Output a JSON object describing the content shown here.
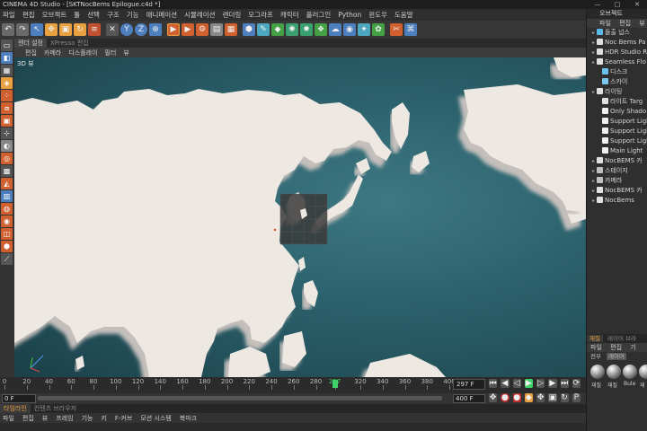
{
  "window": {
    "title": "CINEMA 4D Studio - [SKTNocBems Epilogue.c4d *]",
    "controls": [
      "—",
      "□",
      "✕"
    ]
  },
  "menubar": [
    "파일",
    "편집",
    "오브젝트",
    "툴",
    "선택",
    "구조",
    "기능",
    "애니메이션",
    "시뮬레이션",
    "렌더링",
    "모그라프",
    "캐릭터",
    "플러그인",
    "Python",
    "윈도우",
    "도움말"
  ],
  "viewport_tabs": [
    "렌더 설정",
    "XPresso 편집"
  ],
  "viewport_menu": [
    "편집",
    "카메라",
    "디스플레이",
    "필터",
    "뷰"
  ],
  "viewport_label": "3D 뷰",
  "timeline": {
    "ticks": [
      0,
      20,
      40,
      60,
      80,
      100,
      120,
      140,
      160,
      180,
      200,
      220,
      240,
      260,
      280,
      297,
      320,
      340,
      360,
      380,
      400
    ],
    "current_frame": "297 F",
    "start_field": "0 F",
    "end_field": "400 F"
  },
  "bottom_tabs": [
    "타임라인",
    "컨텐츠 브라우저"
  ],
  "bottom_menu": [
    "파일",
    "편집",
    "뷰",
    "프레임",
    "기능",
    "키",
    "F-커브",
    "모션 시스템",
    "북마크"
  ],
  "right_panel": {
    "header": "오브젝트",
    "menu": [
      "파일",
      "편집",
      "뷰"
    ],
    "objects": [
      {
        "label": "돌출 넙스",
        "icon": "extrude-icon",
        "color": "#5ab8e8"
      },
      {
        "label": "Noc Bems Pa",
        "icon": "null-icon",
        "color": "#e0e0e0"
      },
      {
        "label": "HDR Studio Ri",
        "icon": "null-icon",
        "color": "#e0e0e0"
      },
      {
        "label": "Seamless Flo",
        "icon": "null-icon",
        "color": "#e0e0e0"
      },
      {
        "label": "디스크",
        "icon": "disc-icon",
        "color": "#6cc0f0"
      },
      {
        "label": "스카이",
        "icon": "sky-icon",
        "color": "#7ac8f0"
      },
      {
        "label": "라이팅",
        "icon": "null-icon",
        "color": "#e0e0e0"
      },
      {
        "label": "라이트 Targ",
        "icon": "null-icon",
        "color": "#e0e0e0"
      },
      {
        "label": "Only Shado",
        "icon": "light-icon",
        "color": "#f0f0f0"
      },
      {
        "label": "Support Ligh",
        "icon": "light-icon",
        "color": "#f0f0f0"
      },
      {
        "label": "Support Ligh",
        "icon": "light-icon",
        "color": "#f0f0f0"
      },
      {
        "label": "Support Ligh",
        "icon": "light-icon",
        "color": "#f0f0f0"
      },
      {
        "label": "Main Light",
        "icon": "light-icon",
        "color": "#f0f0f0"
      },
      {
        "label": "NocBEMS 카",
        "icon": "null-icon",
        "color": "#e0e0e0"
      },
      {
        "label": "스테이지",
        "icon": "stage-icon",
        "color": "#c0c0c0"
      },
      {
        "label": "카메라",
        "icon": "camera-icon",
        "color": "#c0c0c0"
      },
      {
        "label": "NocBEMS 카",
        "icon": "null-icon",
        "color": "#e0e0e0"
      },
      {
        "label": "NocBems",
        "icon": "null-icon",
        "color": "#e0e0e0"
      }
    ],
    "material_tabs": [
      "재질",
      "레이어 브라"
    ],
    "material_menu": [
      "파일",
      "편집",
      "기"
    ],
    "material_filter": [
      "전부",
      "레이어"
    ],
    "materials": [
      "재질",
      "재질",
      "Bule",
      "재"
    ]
  },
  "colors": {
    "accent": "#e8a040",
    "playhead": "#3fd16b",
    "land": "#ede8e1",
    "ocean": "#2a5f6a"
  }
}
